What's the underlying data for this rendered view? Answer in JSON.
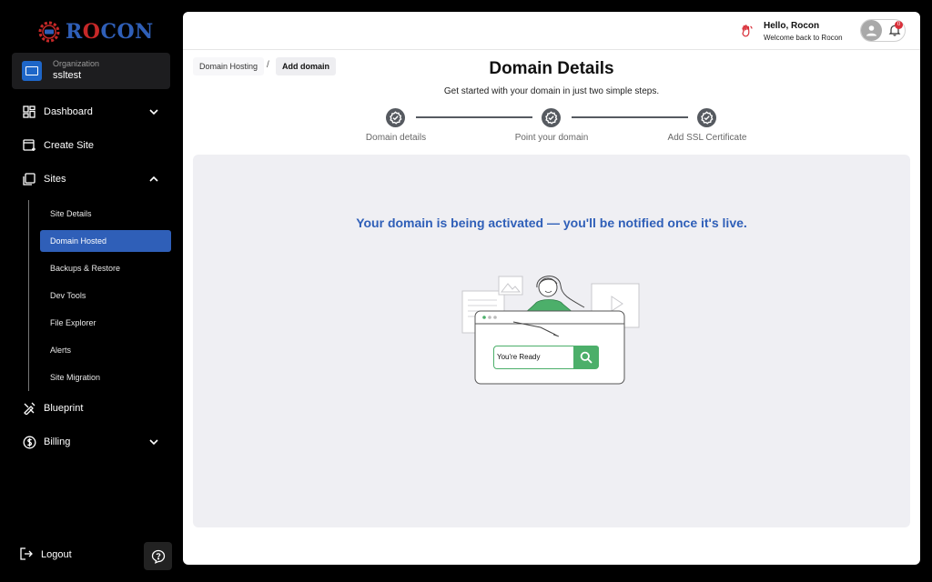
{
  "brand": {
    "name_blue_left": "R",
    "name_red": "O",
    "name_blue_right": "CON",
    "primary_color": "#2f5fb8",
    "accent_color": "#c62828"
  },
  "organization": {
    "label": "Organization",
    "name": "ssltest"
  },
  "sidebar": {
    "items": [
      {
        "label": "Dashboard",
        "icon": "dashboard-icon",
        "expanded": false
      },
      {
        "label": "Create Site",
        "icon": "create-site-icon"
      },
      {
        "label": "Sites",
        "icon": "sites-icon",
        "expanded": true
      },
      {
        "label": "Blueprint",
        "icon": "blueprint-icon"
      },
      {
        "label": "Billing",
        "icon": "billing-icon",
        "expanded": false
      }
    ],
    "sub_items": [
      {
        "label": "Site Details"
      },
      {
        "label": "Domain Hosted",
        "active": true
      },
      {
        "label": "Backups & Restore"
      },
      {
        "label": "Dev Tools"
      },
      {
        "label": "File Explorer"
      },
      {
        "label": "Alerts"
      },
      {
        "label": "Site Migration"
      }
    ],
    "logout_label": "Logout"
  },
  "header": {
    "greeting": "Hello, Rocon",
    "welcome": "Welcome back to Rocon",
    "notification_count": "0"
  },
  "breadcrumb": {
    "parent": "Domain Hosting",
    "separator": "/",
    "current": "Add domain"
  },
  "page": {
    "title": "Domain Details",
    "subtitle": "Get started with your domain in just two simple steps."
  },
  "steps": [
    {
      "label": "Domain details",
      "done": true
    },
    {
      "label": "Point your domain",
      "done": true
    },
    {
      "label": "Add SSL Certificate",
      "done": true
    }
  ],
  "status": {
    "message": "Your domain is being activated — you'll be notified once it's live.",
    "search_text": "You're Ready"
  }
}
